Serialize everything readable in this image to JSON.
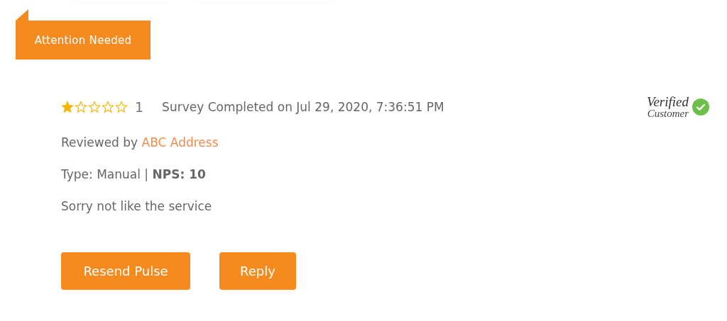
{
  "flag": {
    "label": "Attention Needed"
  },
  "review": {
    "stars": 1,
    "rating": "1",
    "completed": "Survey Completed on Jul 29, 2020, 7:36:51 PM",
    "verified": {
      "line_1": "Verified",
      "line_2": "Customer"
    },
    "reviewed_by_label": "Reviewed by",
    "reviewer": "ABC Address",
    "type_text": "Type: Manual | **NPS: 10**",
    "comment": "Sorry not like the service"
  },
  "buttons": [
    "Resend Pulse",
    "Reply"
  ]
}
